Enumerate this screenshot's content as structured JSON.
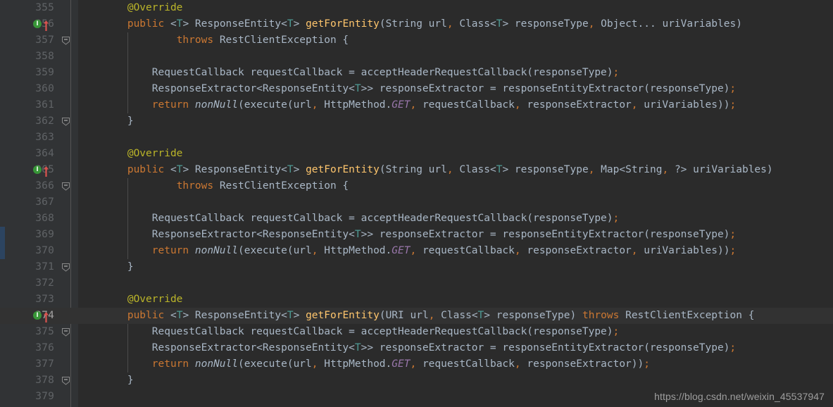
{
  "editor": {
    "theme": "darcula",
    "language": "java",
    "background_color": "#2b2b2b",
    "gutter_color": "#313335",
    "current_line_number": 374,
    "first_visible_line": 355,
    "last_visible_line": 379
  },
  "colors": {
    "keyword": "#cc7832",
    "annotation": "#bbb529",
    "method_declaration": "#ffc66d",
    "generic_type": "#4e9a94",
    "static_field": "#9876aa",
    "default_text": "#a9b7c6",
    "line_number": "#606366",
    "current_line_number": "#a4a3a3",
    "vcs_marker": "#2c4460",
    "implements_icon": "#389638",
    "override_arrow": "#d9534f"
  },
  "gutter": {
    "icon_lines": [
      356,
      365,
      374
    ],
    "implements_icon_label": "I",
    "fold_lines": [
      357,
      362,
      366,
      371,
      375,
      378
    ],
    "vcs_change_lines": [
      369,
      370
    ]
  },
  "watermark": {
    "text": "https://blog.csdn.net/weixin_45537947"
  },
  "lines": [
    {
      "number": 355,
      "indent": 0,
      "tokens": [
        {
          "t": "        ",
          "c": "plain"
        },
        {
          "t": "@Override",
          "c": "anno"
        }
      ]
    },
    {
      "number": 356,
      "indent": 0,
      "icons": true,
      "tokens": [
        {
          "t": "        ",
          "c": "plain"
        },
        {
          "t": "public",
          "c": "kw"
        },
        {
          "t": " <",
          "c": "plain"
        },
        {
          "t": "T",
          "c": "gen"
        },
        {
          "t": "> ",
          "c": "plain"
        },
        {
          "t": "ResponseEntity",
          "c": "typ"
        },
        {
          "t": "<",
          "c": "plain"
        },
        {
          "t": "T",
          "c": "gen"
        },
        {
          "t": "> ",
          "c": "plain"
        },
        {
          "t": "getForEntity",
          "c": "mth"
        },
        {
          "t": "(",
          "c": "plain"
        },
        {
          "t": "String",
          "c": "typ"
        },
        {
          "t": " url",
          "c": "plain"
        },
        {
          "t": ",",
          "c": "pun"
        },
        {
          "t": " ",
          "c": "plain"
        },
        {
          "t": "Class",
          "c": "typ"
        },
        {
          "t": "<",
          "c": "plain"
        },
        {
          "t": "T",
          "c": "gen"
        },
        {
          "t": "> responseType",
          "c": "plain"
        },
        {
          "t": ",",
          "c": "pun"
        },
        {
          "t": " ",
          "c": "plain"
        },
        {
          "t": "Object",
          "c": "typ"
        },
        {
          "t": "... uriVariables)",
          "c": "plain"
        }
      ]
    },
    {
      "number": 357,
      "fold": true,
      "tokens": [
        {
          "t": "                ",
          "c": "plain"
        },
        {
          "t": "throws",
          "c": "kw"
        },
        {
          "t": " ",
          "c": "plain"
        },
        {
          "t": "RestClientException",
          "c": "typ"
        },
        {
          "t": " {",
          "c": "plain"
        }
      ]
    },
    {
      "number": 358,
      "tokens": []
    },
    {
      "number": 359,
      "tokens": [
        {
          "t": "            ",
          "c": "plain"
        },
        {
          "t": "RequestCallback",
          "c": "typ"
        },
        {
          "t": " requestCallback = ",
          "c": "plain"
        },
        {
          "t": "acceptHeaderRequestCallback",
          "c": "call"
        },
        {
          "t": "(responseType)",
          "c": "plain"
        },
        {
          "t": ";",
          "c": "pun"
        }
      ]
    },
    {
      "number": 360,
      "tokens": [
        {
          "t": "            ",
          "c": "plain"
        },
        {
          "t": "ResponseExtractor",
          "c": "typ"
        },
        {
          "t": "<",
          "c": "plain"
        },
        {
          "t": "ResponseEntity",
          "c": "typ"
        },
        {
          "t": "<",
          "c": "plain"
        },
        {
          "t": "T",
          "c": "gen"
        },
        {
          "t": ">> responseExtractor = ",
          "c": "plain"
        },
        {
          "t": "responseEntityExtractor",
          "c": "call"
        },
        {
          "t": "(responseType)",
          "c": "plain"
        },
        {
          "t": ";",
          "c": "pun"
        }
      ]
    },
    {
      "number": 361,
      "tokens": [
        {
          "t": "            ",
          "c": "plain"
        },
        {
          "t": "return",
          "c": "kw"
        },
        {
          "t": " ",
          "c": "plain"
        },
        {
          "t": "nonNull",
          "c": "ital"
        },
        {
          "t": "(",
          "c": "plain"
        },
        {
          "t": "execute",
          "c": "call"
        },
        {
          "t": "(url",
          "c": "plain"
        },
        {
          "t": ",",
          "c": "pun"
        },
        {
          "t": " ",
          "c": "plain"
        },
        {
          "t": "HttpMethod",
          "c": "typ"
        },
        {
          "t": ".",
          "c": "plain"
        },
        {
          "t": "GET",
          "c": "stat"
        },
        {
          "t": ",",
          "c": "pun"
        },
        {
          "t": " requestCallback",
          "c": "plain"
        },
        {
          "t": ",",
          "c": "pun"
        },
        {
          "t": " responseExtractor",
          "c": "plain"
        },
        {
          "t": ",",
          "c": "pun"
        },
        {
          "t": " uriVariables))",
          "c": "plain"
        },
        {
          "t": ";",
          "c": "pun"
        }
      ]
    },
    {
      "number": 362,
      "fold": true,
      "tokens": [
        {
          "t": "        }",
          "c": "plain"
        }
      ]
    },
    {
      "number": 363,
      "tokens": []
    },
    {
      "number": 364,
      "tokens": [
        {
          "t": "        ",
          "c": "plain"
        },
        {
          "t": "@Override",
          "c": "anno"
        }
      ]
    },
    {
      "number": 365,
      "icons": true,
      "tokens": [
        {
          "t": "        ",
          "c": "plain"
        },
        {
          "t": "public",
          "c": "kw"
        },
        {
          "t": " <",
          "c": "plain"
        },
        {
          "t": "T",
          "c": "gen"
        },
        {
          "t": "> ",
          "c": "plain"
        },
        {
          "t": "ResponseEntity",
          "c": "typ"
        },
        {
          "t": "<",
          "c": "plain"
        },
        {
          "t": "T",
          "c": "gen"
        },
        {
          "t": "> ",
          "c": "plain"
        },
        {
          "t": "getForEntity",
          "c": "mth"
        },
        {
          "t": "(",
          "c": "plain"
        },
        {
          "t": "String",
          "c": "typ"
        },
        {
          "t": " url",
          "c": "plain"
        },
        {
          "t": ",",
          "c": "pun"
        },
        {
          "t": " ",
          "c": "plain"
        },
        {
          "t": "Class",
          "c": "typ"
        },
        {
          "t": "<",
          "c": "plain"
        },
        {
          "t": "T",
          "c": "gen"
        },
        {
          "t": "> responseType",
          "c": "plain"
        },
        {
          "t": ",",
          "c": "pun"
        },
        {
          "t": " ",
          "c": "plain"
        },
        {
          "t": "Map",
          "c": "typ"
        },
        {
          "t": "<",
          "c": "plain"
        },
        {
          "t": "String",
          "c": "typ"
        },
        {
          "t": ",",
          "c": "pun"
        },
        {
          "t": " ?> uriVariables)",
          "c": "plain"
        }
      ]
    },
    {
      "number": 366,
      "fold": true,
      "tokens": [
        {
          "t": "                ",
          "c": "plain"
        },
        {
          "t": "throws",
          "c": "kw"
        },
        {
          "t": " ",
          "c": "plain"
        },
        {
          "t": "RestClientException",
          "c": "typ"
        },
        {
          "t": " {",
          "c": "plain"
        }
      ]
    },
    {
      "number": 367,
      "tokens": []
    },
    {
      "number": 368,
      "tokens": [
        {
          "t": "            ",
          "c": "plain"
        },
        {
          "t": "RequestCallback",
          "c": "typ"
        },
        {
          "t": " requestCallback = ",
          "c": "plain"
        },
        {
          "t": "acceptHeaderRequestCallback",
          "c": "call"
        },
        {
          "t": "(responseType)",
          "c": "plain"
        },
        {
          "t": ";",
          "c": "pun"
        }
      ]
    },
    {
      "number": 369,
      "tokens": [
        {
          "t": "            ",
          "c": "plain"
        },
        {
          "t": "ResponseExtractor",
          "c": "typ"
        },
        {
          "t": "<",
          "c": "plain"
        },
        {
          "t": "ResponseEntity",
          "c": "typ"
        },
        {
          "t": "<",
          "c": "plain"
        },
        {
          "t": "T",
          "c": "gen"
        },
        {
          "t": ">> responseExtractor = ",
          "c": "plain"
        },
        {
          "t": "responseEntityExtractor",
          "c": "call"
        },
        {
          "t": "(responseType)",
          "c": "plain"
        },
        {
          "t": ";",
          "c": "pun"
        }
      ]
    },
    {
      "number": 370,
      "tokens": [
        {
          "t": "            ",
          "c": "plain"
        },
        {
          "t": "return",
          "c": "kw"
        },
        {
          "t": " ",
          "c": "plain"
        },
        {
          "t": "nonNull",
          "c": "ital"
        },
        {
          "t": "(",
          "c": "plain"
        },
        {
          "t": "execute",
          "c": "call"
        },
        {
          "t": "(url",
          "c": "plain"
        },
        {
          "t": ",",
          "c": "pun"
        },
        {
          "t": " ",
          "c": "plain"
        },
        {
          "t": "HttpMethod",
          "c": "typ"
        },
        {
          "t": ".",
          "c": "plain"
        },
        {
          "t": "GET",
          "c": "stat"
        },
        {
          "t": ",",
          "c": "pun"
        },
        {
          "t": " requestCallback",
          "c": "plain"
        },
        {
          "t": ",",
          "c": "pun"
        },
        {
          "t": " responseExtractor",
          "c": "plain"
        },
        {
          "t": ",",
          "c": "pun"
        },
        {
          "t": " uriVariables))",
          "c": "plain"
        },
        {
          "t": ";",
          "c": "pun"
        }
      ]
    },
    {
      "number": 371,
      "fold": true,
      "tokens": [
        {
          "t": "        }",
          "c": "plain"
        }
      ]
    },
    {
      "number": 372,
      "tokens": []
    },
    {
      "number": 373,
      "tokens": [
        {
          "t": "        ",
          "c": "plain"
        },
        {
          "t": "@Override",
          "c": "anno"
        }
      ]
    },
    {
      "number": 374,
      "icons": true,
      "current": true,
      "tokens": [
        {
          "t": "        ",
          "c": "plain"
        },
        {
          "t": "public",
          "c": "kw"
        },
        {
          "t": " <",
          "c": "plain"
        },
        {
          "t": "T",
          "c": "gen"
        },
        {
          "t": "> ",
          "c": "plain"
        },
        {
          "t": "ResponseEntity",
          "c": "typ"
        },
        {
          "t": "<",
          "c": "plain"
        },
        {
          "t": "T",
          "c": "gen"
        },
        {
          "t": "> ",
          "c": "plain"
        },
        {
          "t": "getForEntity",
          "c": "mth"
        },
        {
          "t": "(",
          "c": "plain"
        },
        {
          "t": "URI",
          "c": "typ"
        },
        {
          "t": " url",
          "c": "plain"
        },
        {
          "t": ",",
          "c": "pun"
        },
        {
          "t": " ",
          "c": "plain"
        },
        {
          "t": "Class",
          "c": "typ"
        },
        {
          "t": "<",
          "c": "plain"
        },
        {
          "t": "T",
          "c": "gen"
        },
        {
          "t": "> responseType) ",
          "c": "plain"
        },
        {
          "t": "throws",
          "c": "kw"
        },
        {
          "t": " ",
          "c": "plain"
        },
        {
          "t": "RestClientException",
          "c": "typ"
        },
        {
          "t": " {",
          "c": "plain"
        }
      ]
    },
    {
      "number": 375,
      "fold": true,
      "tokens": [
        {
          "t": "            ",
          "c": "plain"
        },
        {
          "t": "RequestCallback",
          "c": "typ"
        },
        {
          "t": " requestCallback = ",
          "c": "plain"
        },
        {
          "t": "acceptHeaderRequestCallback",
          "c": "call"
        },
        {
          "t": "(responseType)",
          "c": "plain"
        },
        {
          "t": ";",
          "c": "pun"
        }
      ]
    },
    {
      "number": 376,
      "tokens": [
        {
          "t": "            ",
          "c": "plain"
        },
        {
          "t": "ResponseExtractor",
          "c": "typ"
        },
        {
          "t": "<",
          "c": "plain"
        },
        {
          "t": "ResponseEntity",
          "c": "typ"
        },
        {
          "t": "<",
          "c": "plain"
        },
        {
          "t": "T",
          "c": "gen"
        },
        {
          "t": ">> responseExtractor = ",
          "c": "plain"
        },
        {
          "t": "responseEntityExtractor",
          "c": "call"
        },
        {
          "t": "(responseType)",
          "c": "plain"
        },
        {
          "t": ";",
          "c": "pun"
        }
      ]
    },
    {
      "number": 377,
      "tokens": [
        {
          "t": "            ",
          "c": "plain"
        },
        {
          "t": "return",
          "c": "kw"
        },
        {
          "t": " ",
          "c": "plain"
        },
        {
          "t": "nonNull",
          "c": "ital"
        },
        {
          "t": "(",
          "c": "plain"
        },
        {
          "t": "execute",
          "c": "call"
        },
        {
          "t": "(url",
          "c": "plain"
        },
        {
          "t": ",",
          "c": "pun"
        },
        {
          "t": " ",
          "c": "plain"
        },
        {
          "t": "HttpMethod",
          "c": "typ"
        },
        {
          "t": ".",
          "c": "plain"
        },
        {
          "t": "GET",
          "c": "stat"
        },
        {
          "t": ",",
          "c": "pun"
        },
        {
          "t": " requestCallback",
          "c": "plain"
        },
        {
          "t": ",",
          "c": "pun"
        },
        {
          "t": " responseExtractor))",
          "c": "plain"
        },
        {
          "t": ";",
          "c": "pun"
        }
      ]
    },
    {
      "number": 378,
      "fold": true,
      "tokens": [
        {
          "t": "        }",
          "c": "plain"
        }
      ]
    },
    {
      "number": 379,
      "tokens": []
    }
  ]
}
